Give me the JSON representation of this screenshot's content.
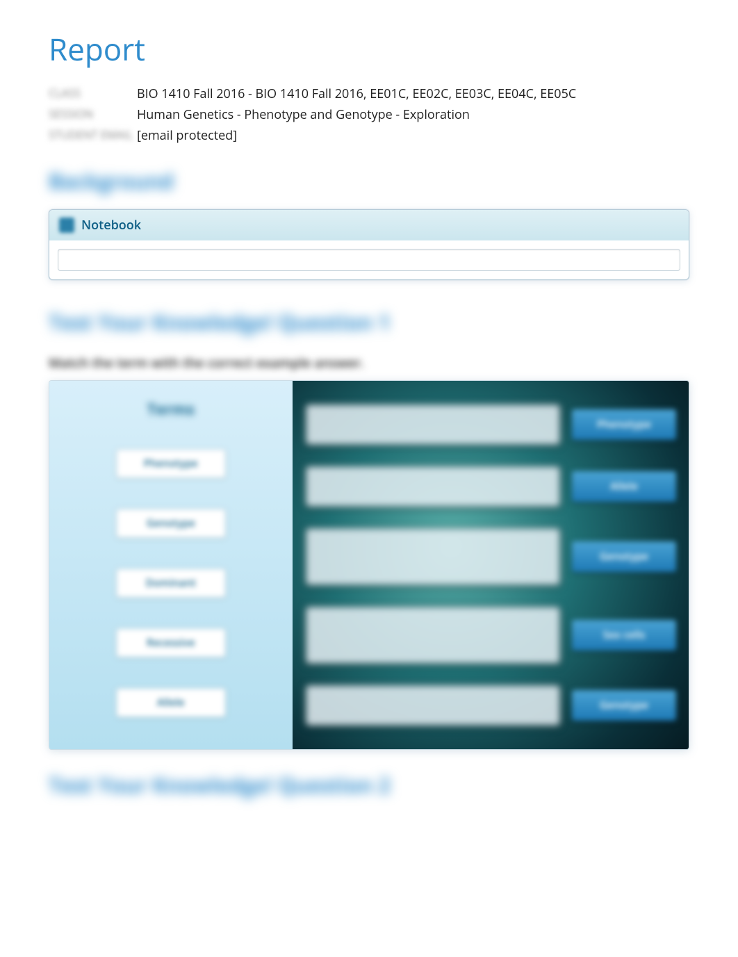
{
  "title": "Report",
  "meta": {
    "label_class": "CLASS",
    "label_session": "SESSION",
    "label_student": "STUDENT EMAIL",
    "class_value": "BIO 1410 Fall 2016 - BIO 1410 Fall 2016, EE01C, EE02C, EE03C, EE04C, EE05C",
    "session_value": "Human Genetics - Phenotype and Genotype - Exploration",
    "student_value": "[email protected]"
  },
  "sections": {
    "background_heading": "Background",
    "q1_heading": "Test Your Knowledge! Question 1",
    "q2_heading": "Test Your Knowledge! Question 2"
  },
  "notebook": {
    "label": "Notebook",
    "input_value": ""
  },
  "question1": {
    "instruction": "Match the term with the correct example answer.",
    "terms_heading": "Terms",
    "left_terms": [
      "Phenotype",
      "Genotype",
      "Dominant",
      "Recessive",
      "Allele"
    ],
    "right_answers": [
      "Phenotype",
      "Allele",
      "Genotype",
      "Sex cells",
      "Genotype"
    ]
  }
}
